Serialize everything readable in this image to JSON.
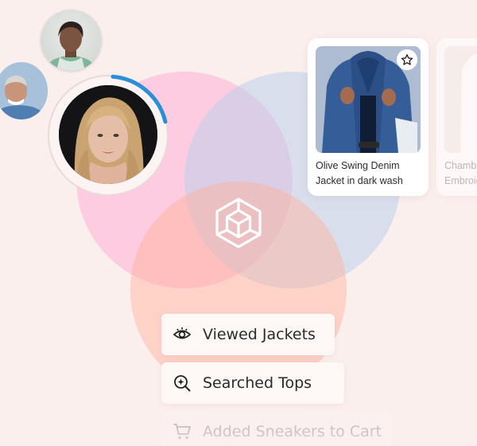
{
  "venn": {
    "colors": {
      "pink": "#ff9ccc",
      "blue": "#bed0ec",
      "peach": "#ffb096"
    },
    "center_icon": "cube-icon"
  },
  "users": {
    "avatars": [
      {
        "name": "avatar-woman-top",
        "icon": "person-photo"
      },
      {
        "name": "avatar-man-left",
        "icon": "person-photo"
      },
      {
        "name": "avatar-main",
        "icon": "person-photo",
        "progress": 0.2,
        "progress_color": "#2a8fd6"
      }
    ]
  },
  "products": [
    {
      "title": "Olive Swing Denim Jacket in dark wash",
      "badge_icon": "star-icon"
    },
    {
      "title": "Chambray Embroidered"
    }
  ],
  "activity": {
    "viewed": {
      "label": "Viewed Jackets",
      "icon": "eye-icon"
    },
    "searched": {
      "label": "Searched Tops",
      "icon": "search-sparkle-icon"
    },
    "cart": {
      "label": "Added Sneakers to Cart",
      "icon": "cart-icon"
    }
  }
}
